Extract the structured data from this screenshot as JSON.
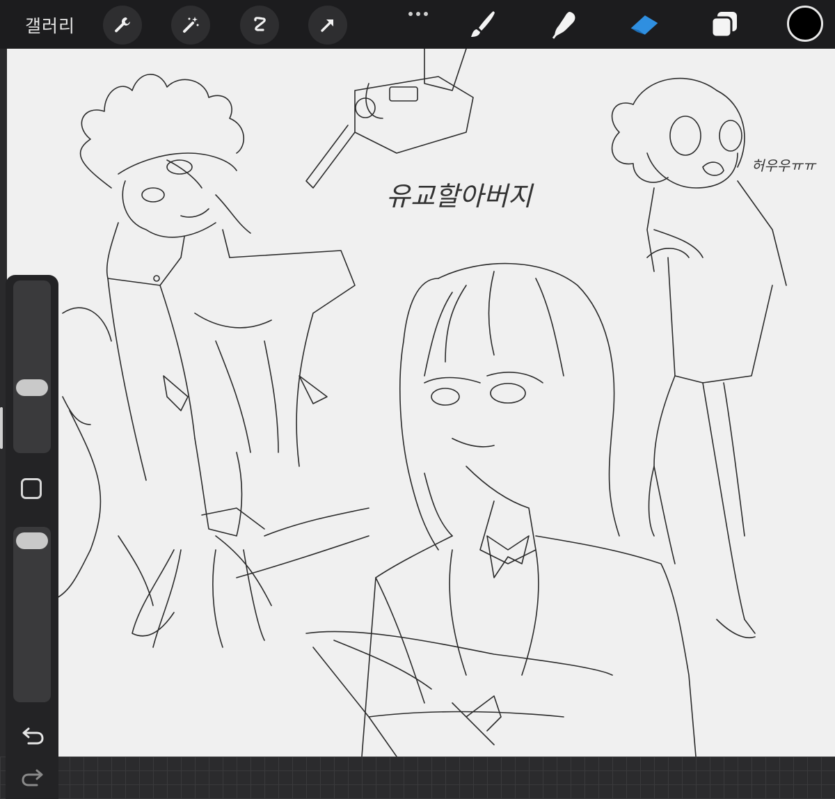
{
  "topbar": {
    "gallery_label": "갤러리",
    "left_tools": [
      "wrench-icon",
      "magic-wand-icon",
      "selection-icon",
      "transform-arrow-icon"
    ],
    "right_tools": [
      "brush-icon",
      "smudge-icon",
      "eraser-icon",
      "layers-icon"
    ],
    "active_tool": "eraser-icon",
    "accent_color": "#2f8fe0",
    "current_color": "#000000"
  },
  "canvas": {
    "background": "#f0f0f0",
    "handwritten_text_1": "유교할아버지",
    "handwritten_text_2": "허우우ㅠㅠ"
  },
  "sidebar": {
    "controls": [
      "brush-size-slider",
      "modify-button",
      "opacity-slider",
      "undo-icon",
      "redo-icon"
    ]
  }
}
